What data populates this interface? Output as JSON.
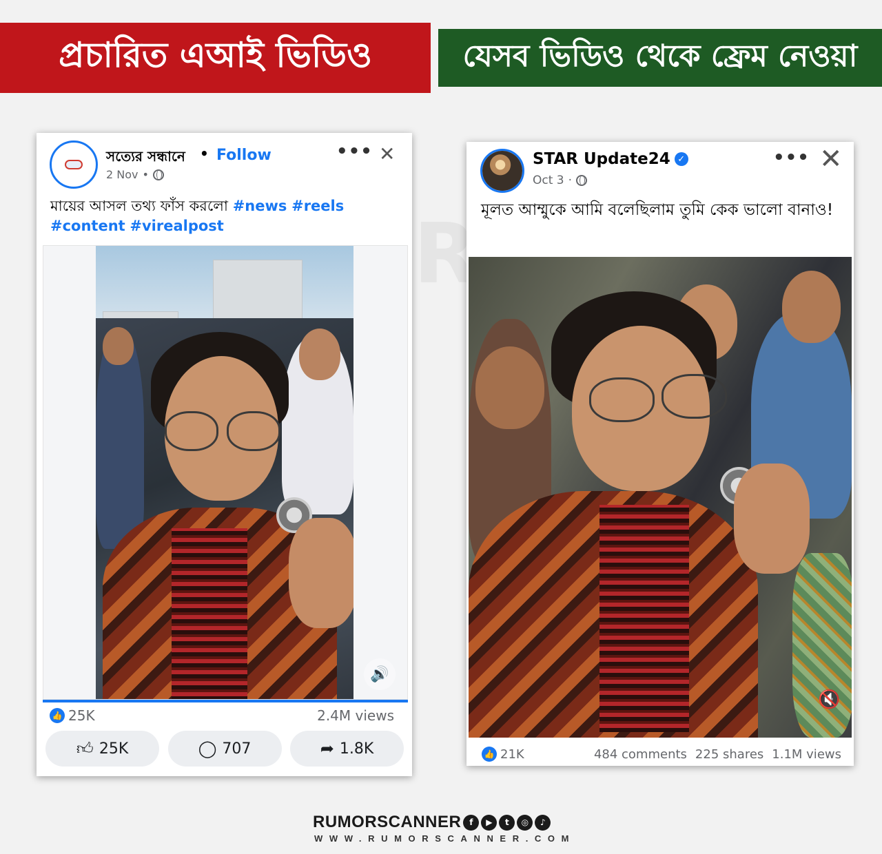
{
  "banners": {
    "left": "প্রচারিত এআই ভিডিও",
    "right": "যেসব ভিডিও থেকে ফ্রেম নেওয়া"
  },
  "left_post": {
    "page_name": "সত্যের সন্ধানে",
    "separator": "•",
    "follow_label": "Follow",
    "date": "2 Nov",
    "date_sep": "•",
    "caption_text": "মায়ের আসল তথ্য ফাঁস করলো",
    "hashtags": [
      "#news",
      "#reels",
      "#content",
      "#virealpost"
    ],
    "reactions": "25K",
    "views": "2.4M views",
    "progress": 1.0,
    "actions": {
      "like": "25K",
      "comment": "707",
      "share": "1.8K"
    }
  },
  "right_post": {
    "page_name": "STAR Update24",
    "date": "Oct 3",
    "date_sep": "·",
    "caption_text": "মূলত আম্মুকে আমি বলেছিলাম তুমি কেক ভালো বানাও!",
    "reactions": "21K",
    "comments": "484 comments",
    "shares": "225 shares",
    "views": "1.1M views"
  },
  "icons": {
    "more": "more-options-icon",
    "close": "close-icon",
    "globe": "globe-icon",
    "like": "thumbs-up-icon",
    "comment": "comment-icon",
    "share": "share-icon",
    "sound": "speaker-icon",
    "mute": "muted-speaker-icon",
    "verified": "verified-badge-icon"
  },
  "colors": {
    "banner_left": "#c0161b",
    "banner_right": "#1e5b24",
    "facebook_blue": "#1877f2"
  },
  "footer": {
    "brand": "RUMORSCANNER",
    "url": "WWW.RUMORSCANNER.COM"
  }
}
